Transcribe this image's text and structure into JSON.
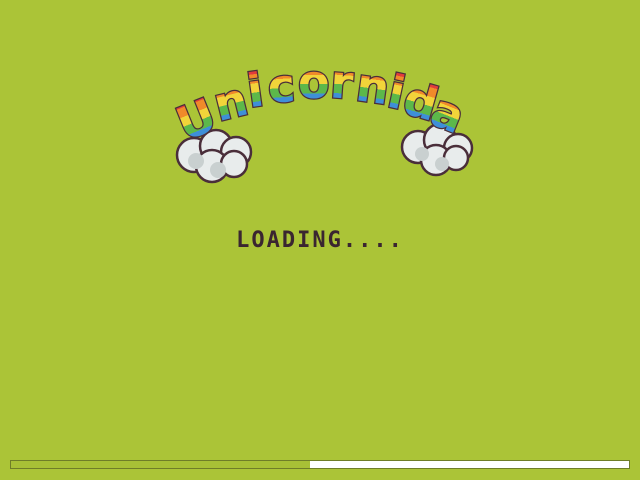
{
  "game": {
    "logo_text": "Unicornida",
    "loading_label": "Loading....",
    "progress_fraction": 0.484
  },
  "colors": {
    "background": "#abc437",
    "text": "#3a2630",
    "progress_empty": "#ffffff",
    "progress_filled": "#a8c036",
    "rainbow": [
      "#e23b3b",
      "#f08a2a",
      "#f2d43a",
      "#5cb84a",
      "#3e8fd8",
      "#8a5bc8"
    ],
    "cloud": "#e8ecec",
    "outline": "#4a2e3a"
  }
}
